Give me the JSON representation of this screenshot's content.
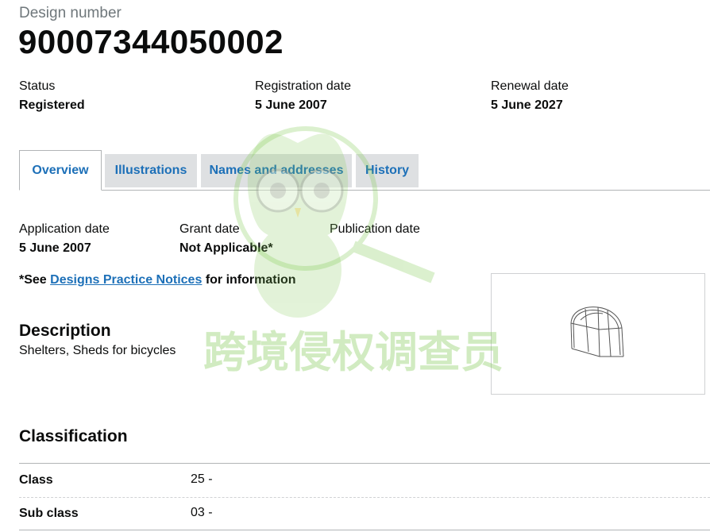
{
  "header": {
    "caption": "Design number",
    "design_number": "90007344050002"
  },
  "summary": {
    "status_label": "Status",
    "status_value": "Registered",
    "registration_label": "Registration date",
    "registration_value": "5 June 2007",
    "renewal_label": "Renewal date",
    "renewal_value": "5 June 2027"
  },
  "tabs": [
    {
      "label": "Overview",
      "active": true
    },
    {
      "label": "Illustrations",
      "active": false
    },
    {
      "label": "Names and addresses",
      "active": false
    },
    {
      "label": "History",
      "active": false
    }
  ],
  "overview": {
    "application_label": "Application date",
    "application_value": "5 June 2007",
    "grant_label": "Grant date",
    "grant_value": "Not Applicable*",
    "publication_label": "Publication date",
    "publication_value": "",
    "note_prefix": "*See",
    "note_link": "Designs Practice Notices",
    "note_suffix": "for information",
    "description_heading": "Description",
    "description_text": "Shelters, Sheds for bicycles",
    "classification_heading": "Classification",
    "classification_rows": [
      {
        "key": "Class",
        "value": "25 -"
      },
      {
        "key": "Sub class",
        "value": "03 -"
      }
    ]
  },
  "watermark": {
    "text": "跨境侵权调查员"
  },
  "colors": {
    "link": "#1d70b8",
    "tab_inactive_bg": "#dee0e2",
    "border": "#b1b4b6",
    "watermark_green": "#7ec850"
  }
}
